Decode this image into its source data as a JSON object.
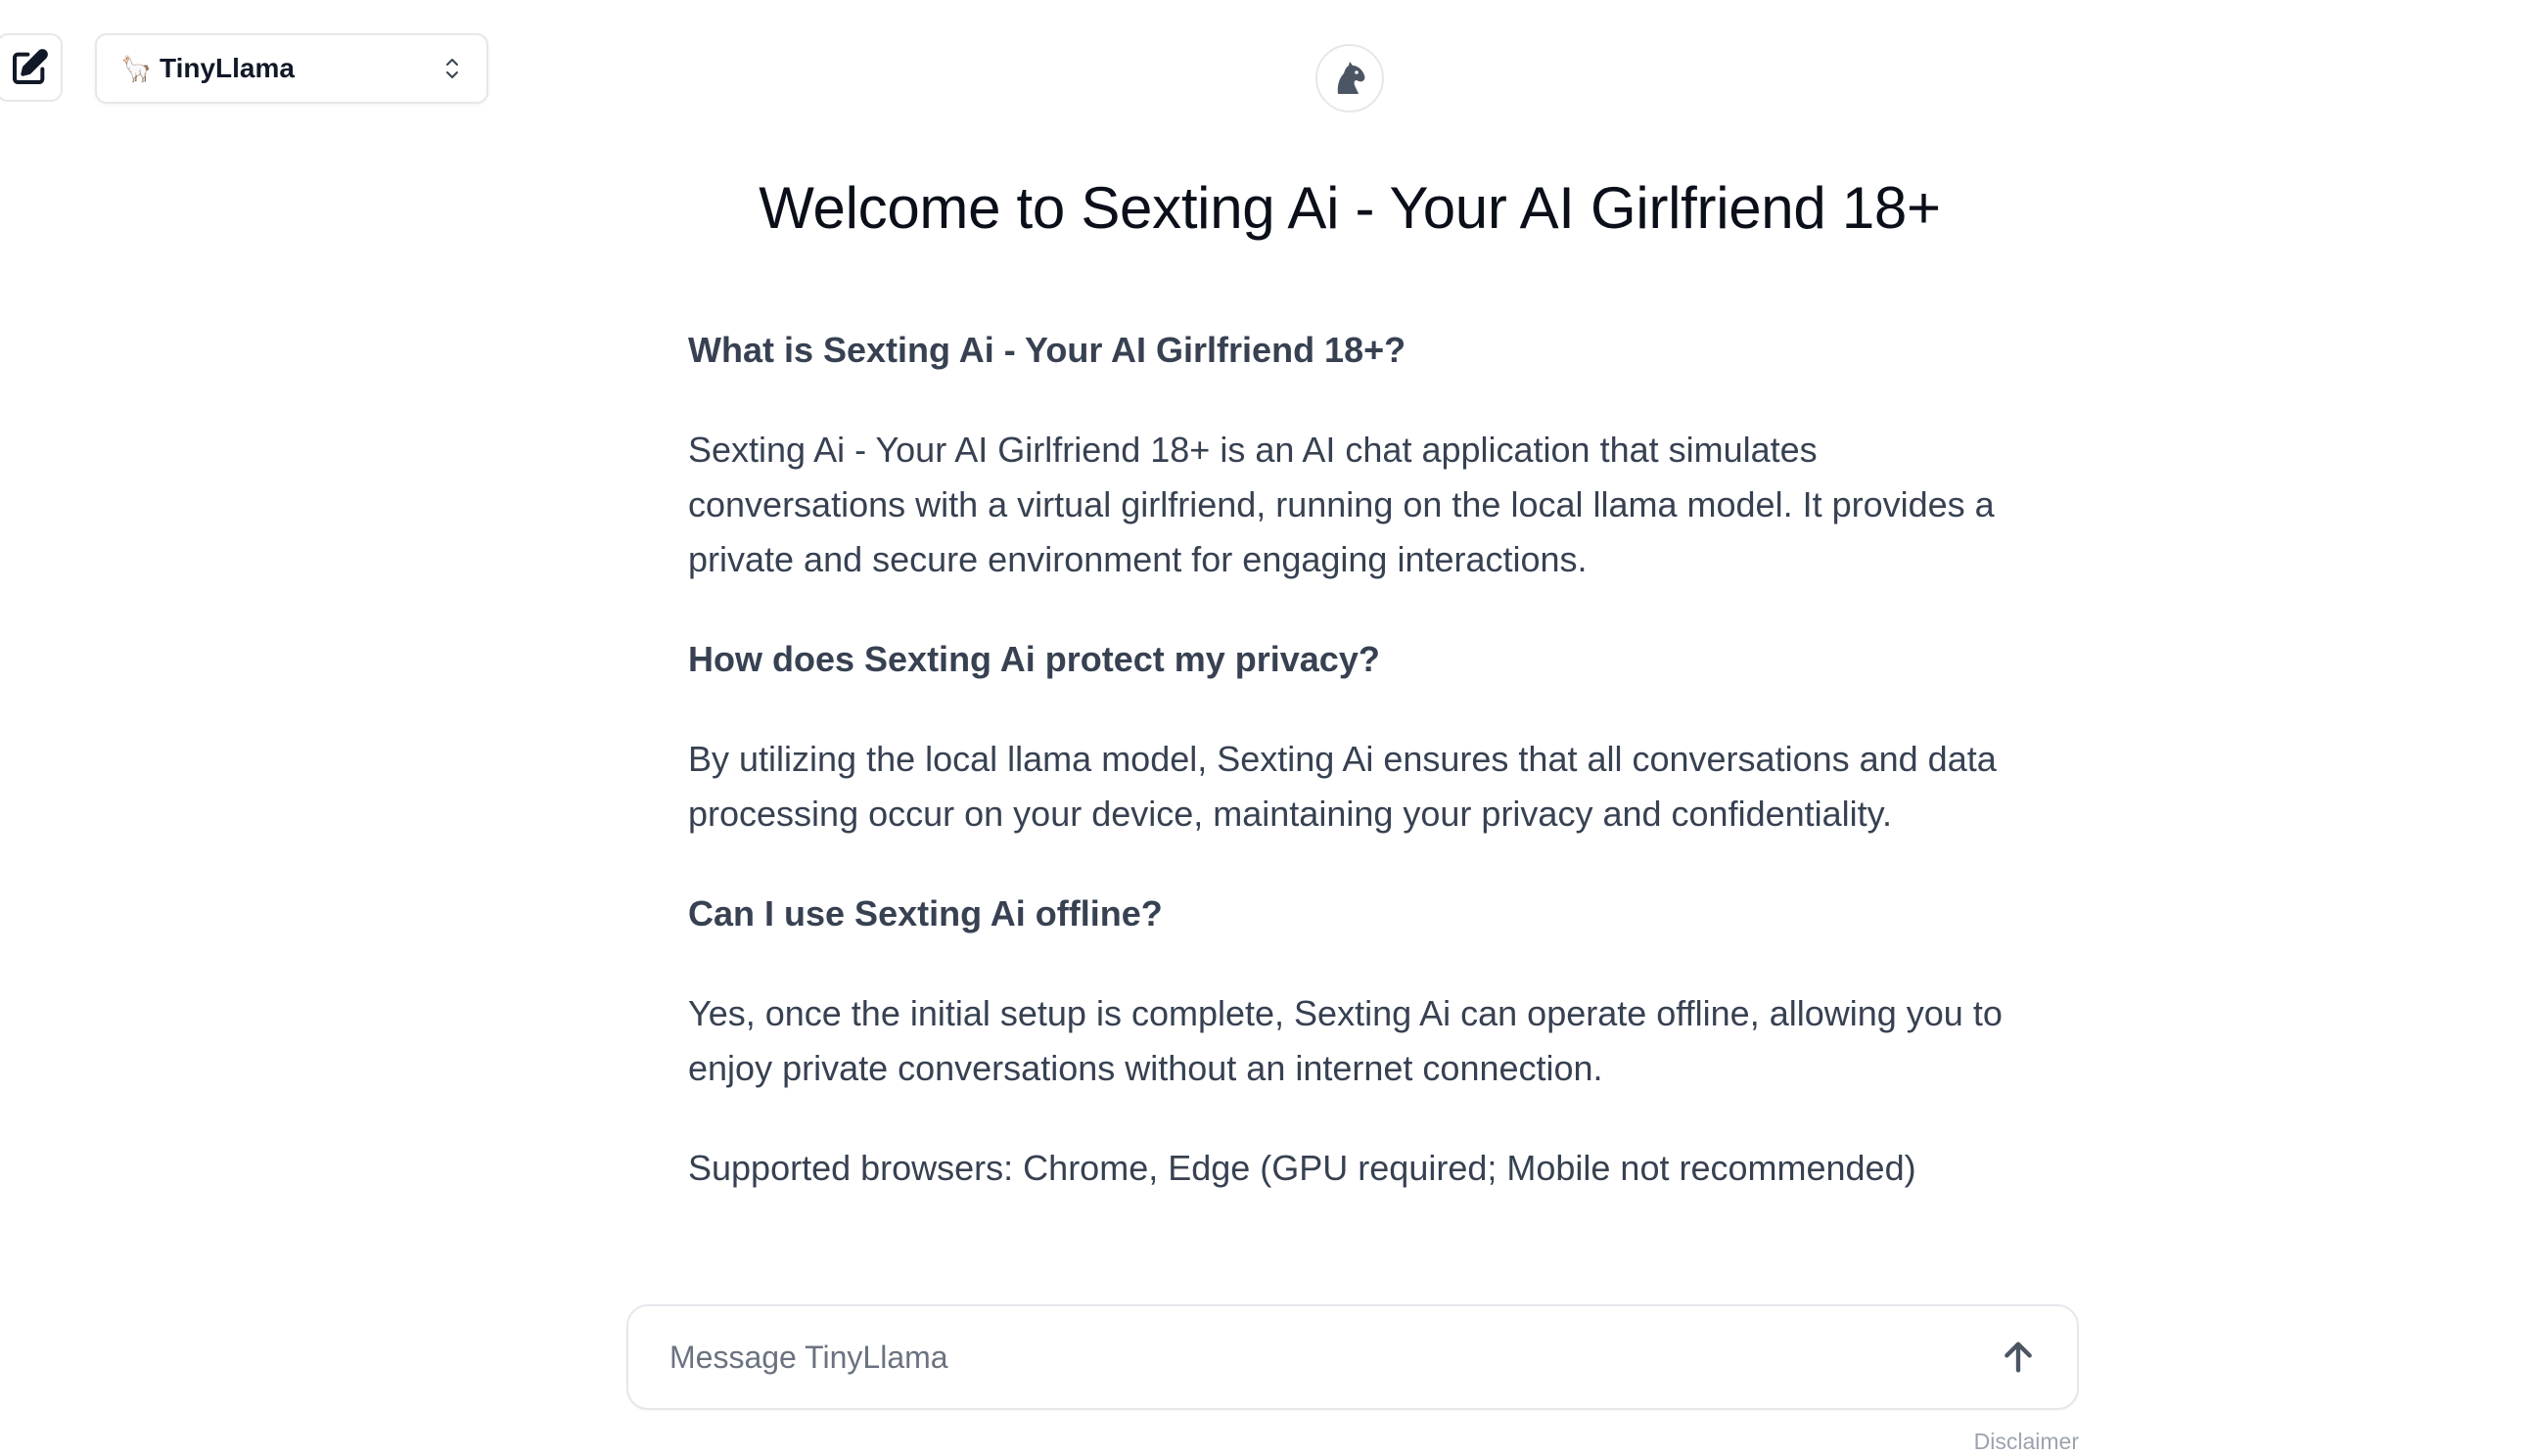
{
  "header": {
    "new_chat_icon": "edit-icon",
    "model_selector": {
      "emoji": "🦙",
      "selected_model": "TinyLlama",
      "icon": "chevron-up-down-icon"
    },
    "logo_icon": "horse-head-icon"
  },
  "main": {
    "title": "Welcome to Sexting Ai - Your AI Girlfriend 18+",
    "faq": [
      {
        "question": "What is Sexting Ai - Your AI Girlfriend 18+?",
        "answer": "Sexting Ai - Your AI Girlfriend 18+ is an AI chat application that simulates conversations with a virtual girlfriend, running on the local llama model. It provides a private and secure environment for engaging interactions."
      },
      {
        "question": "How does Sexting Ai protect my privacy?",
        "answer": "By utilizing the local llama model, Sexting Ai ensures that all conversations and data processing occur on your device, maintaining your privacy and confidentiality."
      },
      {
        "question": "Can I use Sexting Ai offline?",
        "answer": "Yes, once the initial setup is complete, Sexting Ai can operate offline, allowing you to enjoy private conversations without an internet connection."
      }
    ],
    "supported_browsers": "Supported browsers: Chrome, Edge (GPU required; Mobile not recommended)"
  },
  "composer": {
    "placeholder": "Message TinyLlama",
    "value": "",
    "send_icon": "arrow-up-icon"
  },
  "footer": {
    "disclaimer": "Disclaimer"
  },
  "colors": {
    "text_primary": "#0b0f19",
    "text_body": "#374151",
    "border": "#e5e7eb",
    "placeholder": "#6b7280",
    "muted": "#9ca3af"
  }
}
